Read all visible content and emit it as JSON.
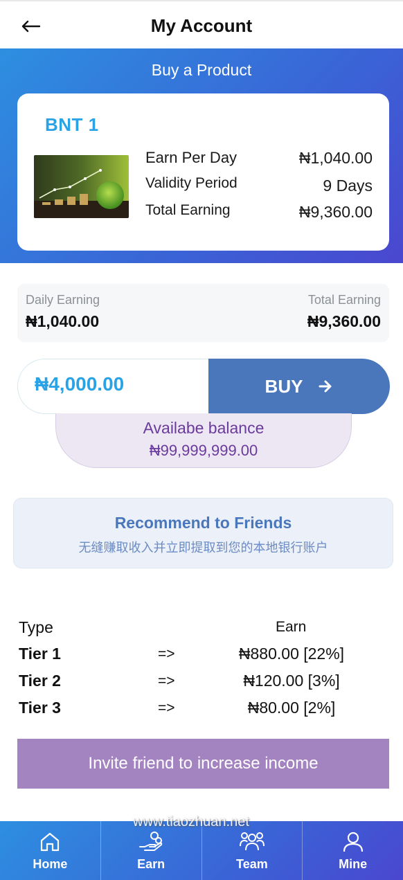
{
  "header": {
    "title": "My Account"
  },
  "banner": {
    "title": "Buy a Product",
    "product": {
      "name": "BNT 1",
      "rows": [
        {
          "label": "Earn Per Day",
          "value": "₦1,040.00"
        },
        {
          "label": "Validity Period",
          "value": "9 Days"
        },
        {
          "label": "Total Earning",
          "value": "₦9,360.00"
        }
      ]
    }
  },
  "earnings": {
    "daily_label": "Daily Earning",
    "daily_value": "₦1,040.00",
    "total_label": "Total Earning",
    "total_value": "₦9,360.00"
  },
  "buy": {
    "amount": "₦4,000.00",
    "button_label": "BUY"
  },
  "balance": {
    "label": "Availabe balance",
    "value": "₦99,999,999.00"
  },
  "recommend": {
    "title": "Recommend to Friends",
    "subtitle": "无缝赚取收入并立即提取到您的本地银行账户"
  },
  "tiers": {
    "type_header": "Type",
    "earn_header": "Earn",
    "rows": [
      {
        "name": "Tier 1",
        "arrow": "=>",
        "earn": "₦880.00 [22%]"
      },
      {
        "name": "Tier 2",
        "arrow": "=>",
        "earn": "₦120.00 [3%]"
      },
      {
        "name": "Tier 3",
        "arrow": "=>",
        "earn": "₦80.00 [2%]"
      }
    ]
  },
  "invite": {
    "label": "Invite friend to increase income"
  },
  "watermark": "www.tiaozhuan.net",
  "nav": {
    "items": [
      {
        "label": "Home",
        "icon": "home-icon"
      },
      {
        "label": "Earn",
        "icon": "hand-coins-icon"
      },
      {
        "label": "Team",
        "icon": "team-icon"
      },
      {
        "label": "Mine",
        "icon": "user-icon"
      }
    ]
  },
  "colors": {
    "accent_blue": "#2aa3e6",
    "button_blue": "#4a76bc",
    "purple": "#a383c0",
    "balance_text": "#6a3a9c"
  }
}
